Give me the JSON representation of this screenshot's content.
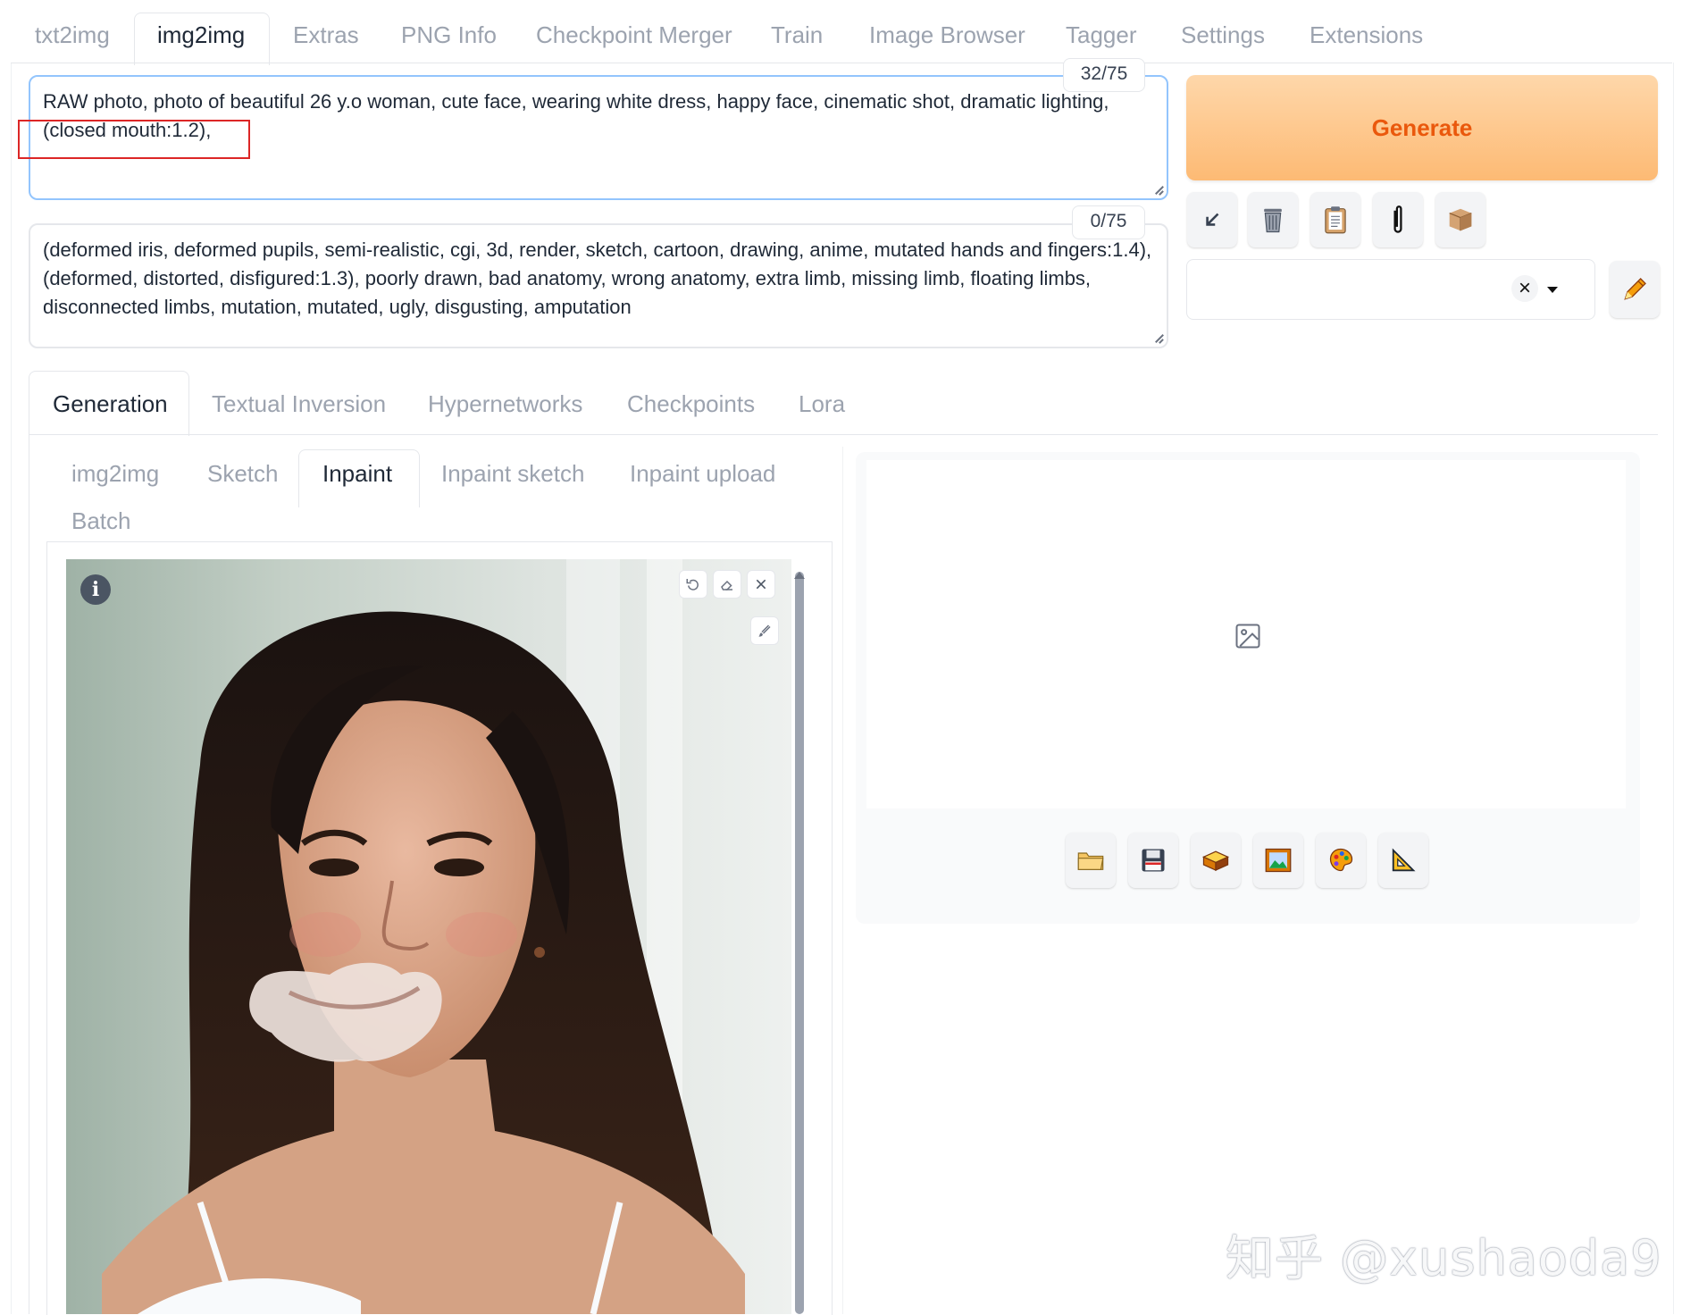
{
  "top_tabs": [
    "txt2img",
    "img2img",
    "Extras",
    "PNG Info",
    "Checkpoint Merger",
    "Train",
    "Image Browser",
    "Tagger",
    "Settings",
    "Extensions"
  ],
  "active_top_tab": "img2img",
  "prompt": {
    "text": "RAW photo, photo of beautiful 26 y.o woman, cute face, wearing white dress, happy face, cinematic shot, dramatic lighting, (closed mouth:1.2),",
    "token_count": "32/75"
  },
  "negative_prompt": {
    "text": "(deformed iris, deformed pupils, semi-realistic, cgi, 3d, render, sketch, cartoon, drawing, anime, mutated hands and fingers:1.4), (deformed, distorted, disfigured:1.3), poorly drawn, bad anatomy, wrong anatomy, extra limb, missing limb, floating limbs, disconnected limbs, mutation, mutated, ugly, disgusting, amputation",
    "token_count": "0/75"
  },
  "generate_label": "Generate",
  "toolbar_icons": [
    "arrow-down-left-icon",
    "trash-icon",
    "clipboard-icon",
    "paperclip-icon",
    "box-icon"
  ],
  "style_select": {
    "value": ""
  },
  "generation_tabs": [
    "Generation",
    "Textual Inversion",
    "Hypernetworks",
    "Checkpoints",
    "Lora"
  ],
  "active_generation_tab": "Generation",
  "img2img_tabs": [
    "img2img",
    "Sketch",
    "Inpaint",
    "Inpaint sketch",
    "Inpaint upload",
    "Batch"
  ],
  "active_img2img_tab": "Inpaint",
  "output_buttons": [
    "folder-icon",
    "save-icon",
    "zip-icon",
    "image-icon",
    "palette-icon",
    "triangle-ruler-icon"
  ],
  "watermark": "知乎 @xushaoda9",
  "colors": {
    "accent": "#ea580c",
    "generate_bg": "#fdba74",
    "highlight": "#dc2626",
    "focus_border": "#93c5fd"
  }
}
